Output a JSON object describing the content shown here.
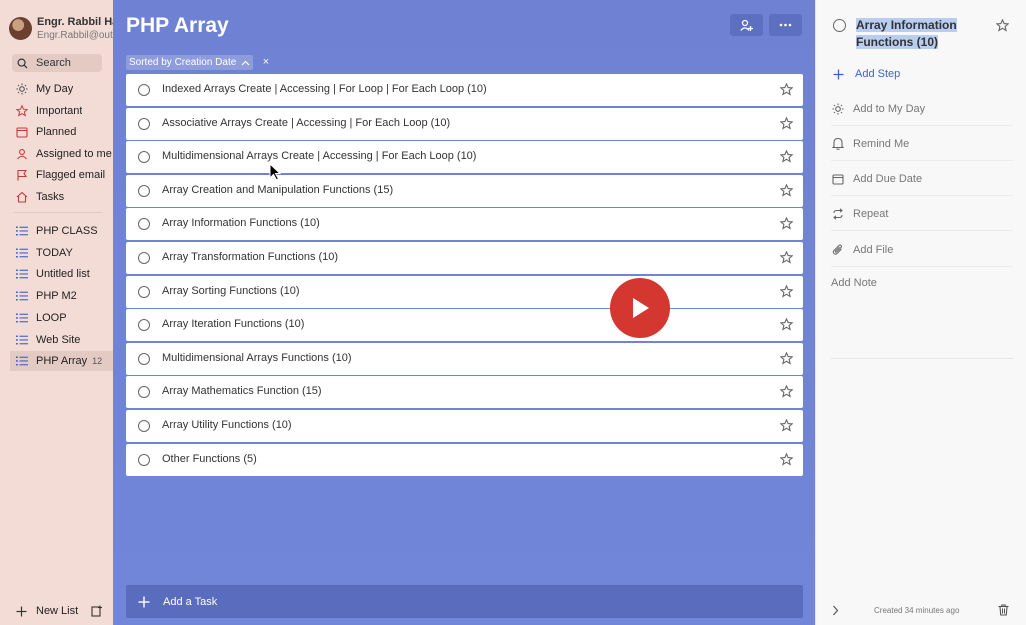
{
  "profile": {
    "name": "Engr. Rabbil Hasan",
    "email": "Engr.Rabbil@outlook.com"
  },
  "search": {
    "label": "Search"
  },
  "smart_lists": [
    {
      "label": "My Day",
      "icon": "sun-icon"
    },
    {
      "label": "Important",
      "icon": "star-icon"
    },
    {
      "label": "Planned",
      "icon": "calendar-icon"
    },
    {
      "label": "Assigned to me",
      "icon": "person-icon"
    },
    {
      "label": "Flagged email",
      "icon": "flag-icon"
    },
    {
      "label": "Tasks",
      "icon": "home-icon"
    }
  ],
  "lists": [
    {
      "label": "PHP CLASS",
      "count": ""
    },
    {
      "label": "TODAY",
      "count": ""
    },
    {
      "label": "Untitled list",
      "count": ""
    },
    {
      "label": "PHP M2",
      "count": ""
    },
    {
      "label": "LOOP",
      "count": ""
    },
    {
      "label": "Web Site",
      "count": ""
    },
    {
      "label": "PHP Array",
      "count": "12"
    }
  ],
  "new_list": {
    "label": "New List"
  },
  "main": {
    "title": "PHP Array",
    "sort_label": "Sorted by Creation Date",
    "tasks": [
      "Indexed Arrays Create | Accessing | For Loop | For Each Loop (10)",
      "Associative Arrays Create | Accessing | For Each Loop (10)",
      "Multidimensional Arrays Create | Accessing | For Each Loop (10)",
      "Array Creation and Manipulation Functions (15)",
      "Array Information Functions (10)",
      "Array Transformation Functions (10)",
      "Array Sorting Functions (10)",
      "Array Iteration Functions (10)",
      "Multidimensional Arrays Functions (10)",
      "Array Mathematics Function (15)",
      "Array Utility Functions (10)",
      "Other Functions (5)"
    ],
    "add_task_label": "Add a Task"
  },
  "detail": {
    "title_line1": "Array Information",
    "title_line2": "Functions (10)",
    "add_step": "Add Step",
    "add_to_my_day": "Add to My Day",
    "remind_me": "Remind Me",
    "add_due_date": "Add Due Date",
    "repeat": "Repeat",
    "add_file": "Add File",
    "add_note": "Add Note",
    "created": "Created 34 minutes ago"
  },
  "colors": {
    "sidebar_bg": "#f3dcd5",
    "main_bg": "#6f81d3",
    "accent": "#3d63c7",
    "play": "#d33730"
  }
}
